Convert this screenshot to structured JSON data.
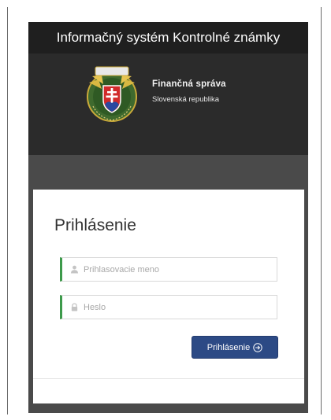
{
  "app": {
    "title": "Informačný systém Kontrolné známky"
  },
  "brand": {
    "name": "Finančná správa",
    "subtitle": "Slovenská republika",
    "emblem_icon": "financna-sprava-emblem",
    "emblem_text_top": "FINANČNÁ SPRÁVA",
    "emblem_text_bottom": "SLOVENSKÁ REPUBLIKA"
  },
  "login": {
    "heading": "Prihlásenie",
    "username_placeholder": "Prihlasovacie meno",
    "username_value": "",
    "username_icon": "user-icon",
    "password_placeholder": "Heslo",
    "password_value": "",
    "password_icon": "lock-icon",
    "submit_label": "Prihlásenie",
    "submit_icon": "arrow-circle-right-icon"
  },
  "colors": {
    "title_bar": "#1f1f1f",
    "header": "#2b2b2b",
    "background": "#4a4a4a",
    "field_accent": "#3d9a4b",
    "button": "#2c4a85"
  }
}
